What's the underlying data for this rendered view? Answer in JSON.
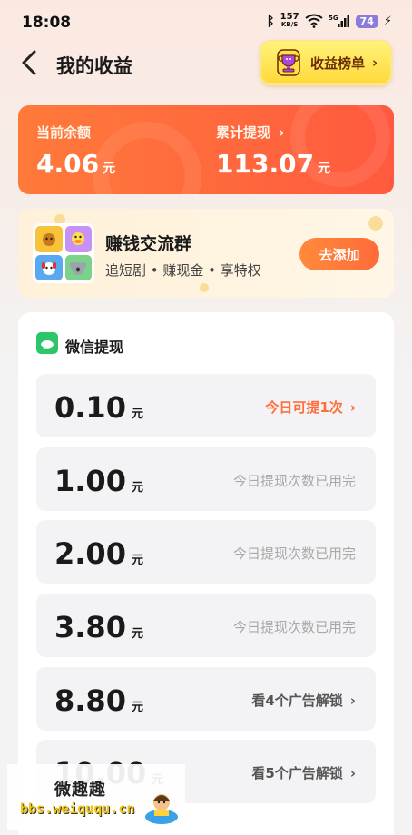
{
  "status_bar": {
    "time": "18:08",
    "net_speed_value": "157",
    "net_speed_unit": "KB/S",
    "battery": "74",
    "icons": [
      "bluetooth-icon",
      "wifi-icon",
      "signal-5g-icon",
      "battery-icon",
      "charging-icon"
    ]
  },
  "header": {
    "title": "我的收益",
    "rank_button": "收益榜单",
    "rank_chevron": "›"
  },
  "balance": {
    "current_label": "当前余额",
    "current_value": "4.06",
    "current_unit": "元",
    "total_label": "累计提现",
    "total_chevron": "›",
    "total_value": "113.07",
    "total_unit": "元"
  },
  "group": {
    "title": "赚钱交流群",
    "subtitle": "追短剧 • 赚现金 • 享特权",
    "button": "去添加"
  },
  "withdraw": {
    "title": "微信提现",
    "options": [
      {
        "amount": "0.10",
        "unit": "元",
        "status": "今日可提1次",
        "chevron": "›"
      },
      {
        "amount": "1.00",
        "unit": "元",
        "status": "今日提现次数已用完"
      },
      {
        "amount": "2.00",
        "unit": "元",
        "status": "今日提现次数已用完"
      },
      {
        "amount": "3.80",
        "unit": "元",
        "status": "今日提现次数已用完"
      },
      {
        "amount": "8.80",
        "unit": "元",
        "status": "看4个广告解锁",
        "chevron": "›"
      },
      {
        "amount": "10.00",
        "unit": "元",
        "status": "看5个广告解锁",
        "chevron": "›"
      }
    ]
  },
  "watermark": {
    "title": "微趣趣",
    "url": "bbs.weiququ.cn"
  },
  "colors": {
    "accent": "#ff6e3a",
    "balance_card": "#ff6a3c",
    "rank_button": "#ffe04a",
    "wechat_green": "#2dc46a"
  }
}
